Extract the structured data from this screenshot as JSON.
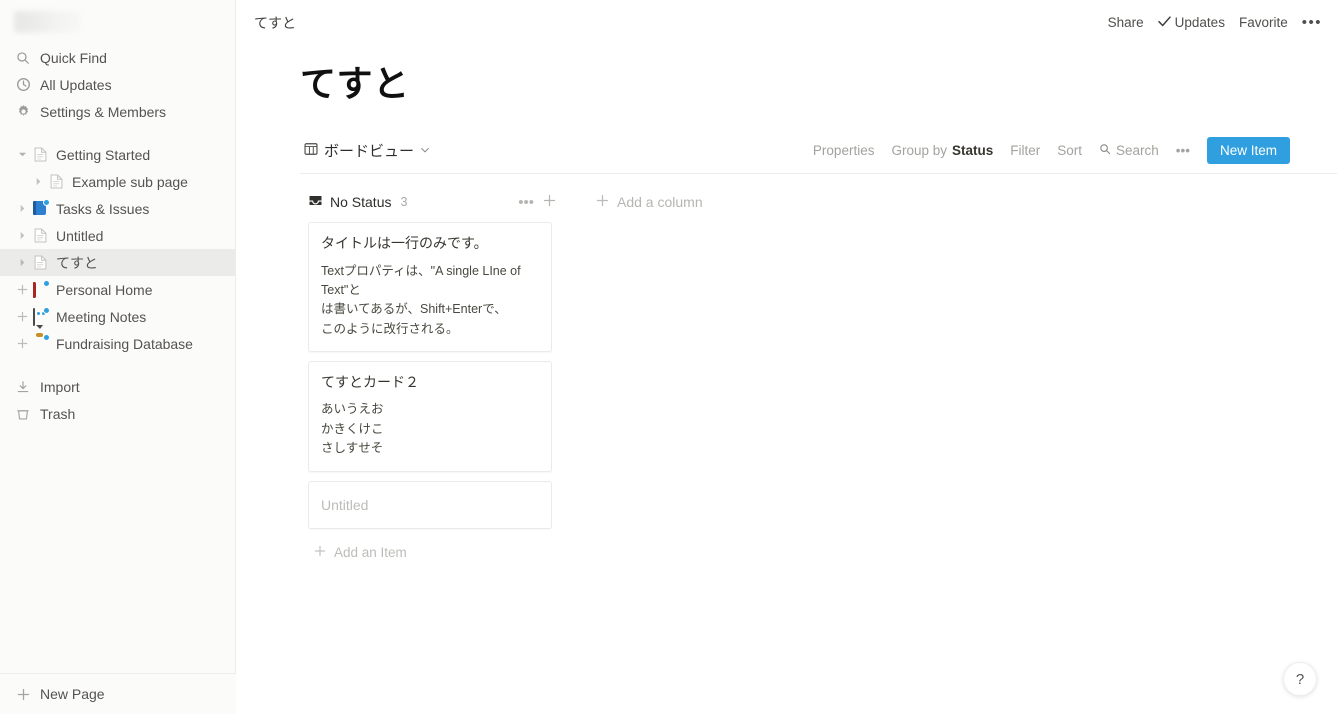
{
  "sidebar": {
    "workspace_name_redacted": "",
    "nav": [
      {
        "label": "Quick Find",
        "icon": "search-icon"
      },
      {
        "label": "All Updates",
        "icon": "clock-icon"
      },
      {
        "label": "Settings & Members",
        "icon": "gear-icon"
      }
    ],
    "pages": [
      {
        "label": "Getting Started",
        "icon": "page-icon",
        "twisty": "down",
        "level": 0,
        "selected": false
      },
      {
        "label": "Example sub page",
        "icon": "page-icon",
        "twisty": "right",
        "level": 1,
        "selected": false
      },
      {
        "label": "Tasks & Issues",
        "icon": "book-blue-emoji",
        "twisty": "right",
        "level": 0,
        "selected": false
      },
      {
        "label": "Untitled",
        "icon": "page-icon",
        "twisty": "right",
        "level": 0,
        "selected": false
      },
      {
        "label": "てすと",
        "icon": "page-icon",
        "twisty": "right",
        "level": 0,
        "selected": true
      }
    ],
    "templates": [
      {
        "label": "Personal Home",
        "icon": "red-book-emoji"
      },
      {
        "label": "Meeting Notes",
        "icon": "speech-bubble-emoji"
      },
      {
        "label": "Fundraising Database",
        "icon": "money-bag-emoji"
      }
    ],
    "utility": [
      {
        "label": "Import",
        "icon": "import-icon"
      },
      {
        "label": "Trash",
        "icon": "trash-icon"
      }
    ],
    "new_page": {
      "label": "New Page",
      "icon": "plus-icon"
    }
  },
  "topbar": {
    "breadcrumb": "てすと",
    "share": "Share",
    "updates": "Updates",
    "favorite": "Favorite",
    "more": "•••"
  },
  "page": {
    "title": "てすと"
  },
  "toolbar": {
    "view_name": "ボードビュー",
    "view_icon": "board-view-icon",
    "properties": "Properties",
    "group_by_prefix": "Group by",
    "group_by_value": "Status",
    "filter": "Filter",
    "sort": "Sort",
    "search": "Search",
    "more": "•••",
    "new_item": "New Item",
    "new_item_color": "#2f9fe0"
  },
  "board": {
    "columns": [
      {
        "name": "No Status",
        "icon": "inbox-icon",
        "count": "3",
        "more": "•••",
        "add": "+",
        "cards": [
          {
            "title": "タイトルは一行のみです。",
            "body": [
              "Textプロパティは、\"A single LIne of Text\"と",
              "は書いてあるが、Shift+Enterで、",
              "このように改行される。"
            ],
            "placeholder": false
          },
          {
            "title": "てすとカード２",
            "body": [
              "あいうえお",
              "かきくけこ",
              "さしすせそ"
            ],
            "placeholder": false
          },
          {
            "title": "Untitled",
            "body": [],
            "placeholder": true
          }
        ],
        "add_item": "Add an Item"
      }
    ],
    "add_a_column": "Add a column"
  },
  "help": {
    "label": "?"
  }
}
